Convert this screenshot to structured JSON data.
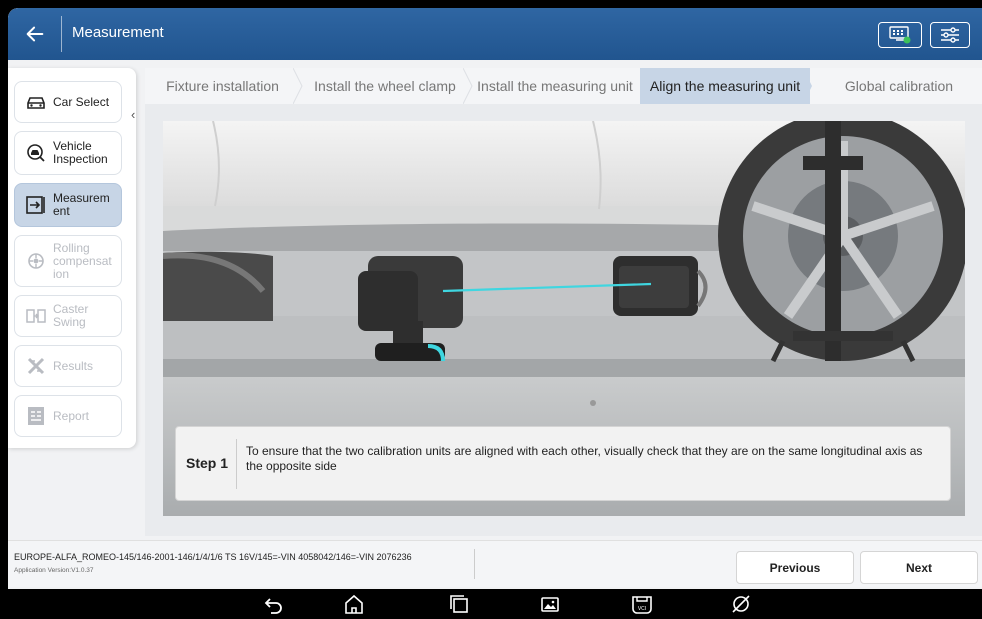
{
  "header": {
    "title": "Measurement",
    "back_icon": "back-arrow-icon",
    "action_icons": [
      "vci-status-icon",
      "settings-sliders-icon"
    ]
  },
  "sidebar": {
    "items": [
      {
        "label": "Car Select",
        "icon": "car-icon",
        "state": "normal"
      },
      {
        "label": "Vehicle\nInspection",
        "icon": "inspection-icon",
        "state": "normal"
      },
      {
        "label": "Measurem\nent",
        "icon": "measurement-icon",
        "state": "active"
      },
      {
        "label": "Rolling\ncompensat\nion",
        "icon": "rolling-icon",
        "state": "disabled"
      },
      {
        "label": "Caster\nSwing",
        "icon": "caster-icon",
        "state": "disabled"
      },
      {
        "label": "Results",
        "icon": "results-icon",
        "state": "disabled"
      },
      {
        "label": "Report",
        "icon": "report-icon",
        "state": "disabled"
      }
    ],
    "collapse_icon": "chevron-left-icon"
  },
  "steps": [
    {
      "label": "Fixture installation",
      "active": false
    },
    {
      "label": "Install the wheel clamp",
      "active": false
    },
    {
      "label": "Install the measuring unit",
      "active": false
    },
    {
      "label": "Align the measuring unit",
      "active": true
    },
    {
      "label": "Global calibration",
      "active": false
    }
  ],
  "instruction": {
    "step_label": "Step 1",
    "text": "To ensure that the two calibration units are aligned with each other, visually check that they are on the same longitudinal axis as the opposite side"
  },
  "footer": {
    "vehicle_info": "EUROPE-ALFA_ROMEO-145/146-2001-146/1/4/1/6 TS 16V/145=-VIN 4058042/146=-VIN 2076236",
    "app_version": "Application Version:V1.0.37",
    "previous_label": "Previous",
    "next_label": "Next"
  },
  "android_nav": [
    "back-nav-icon",
    "home-nav-icon",
    "recents-nav-icon",
    "gallery-nav-icon",
    "vci-nav-icon",
    "browser-nav-icon"
  ],
  "colors": {
    "header_blue": "#2a5f9c",
    "active_step": "#c7d5e6",
    "laser_cyan": "#3fd6e0"
  }
}
